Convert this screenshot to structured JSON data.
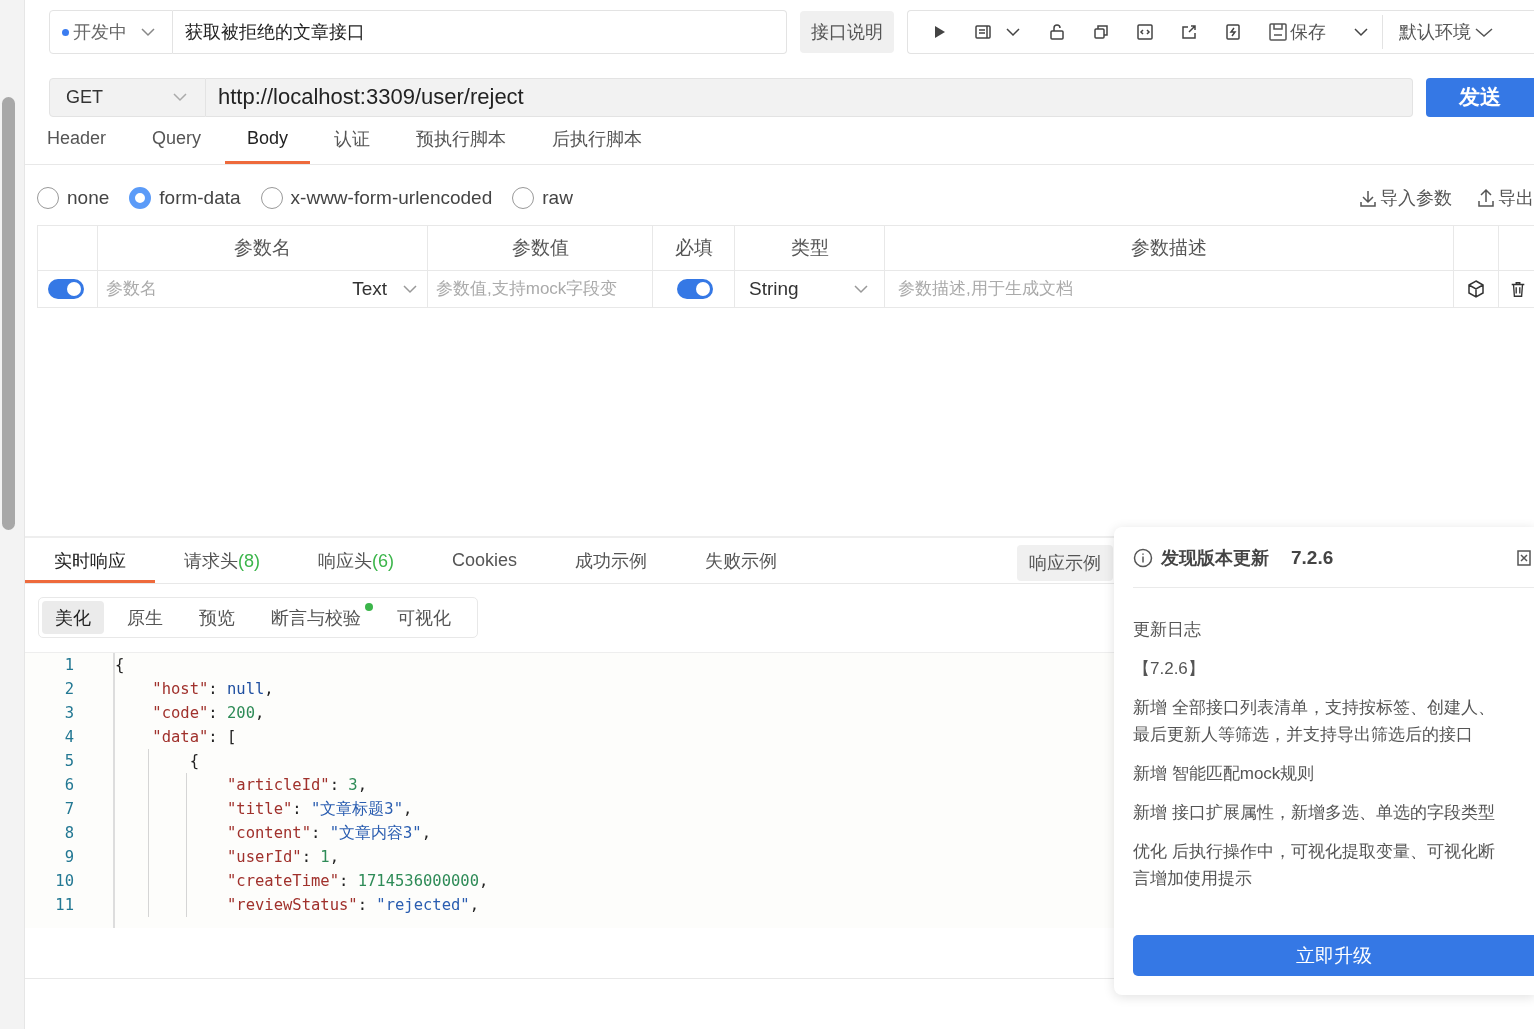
{
  "header": {
    "status": {
      "label": "开发中",
      "color": "#3b7cf0"
    },
    "name_value": "获取被拒绝的文章接口",
    "doc_button": "接口说明",
    "toolbar": {
      "save": "保存",
      "environment": "默认环境"
    }
  },
  "request": {
    "method": "GET",
    "url": "http://localhost:3309/user/reject",
    "send_button": "发送"
  },
  "tabs": [
    {
      "label": "Header",
      "selected": false
    },
    {
      "label": "Query",
      "selected": false
    },
    {
      "label": "Body",
      "selected": true
    },
    {
      "label": "认证",
      "selected": false
    },
    {
      "label": "预执行脚本",
      "selected": false
    },
    {
      "label": "后执行脚本",
      "selected": false
    }
  ],
  "body_types": [
    {
      "label": "none",
      "selected": false
    },
    {
      "label": "form-data",
      "selected": true
    },
    {
      "label": "x-www-form-urlencoded",
      "selected": false
    },
    {
      "label": "raw",
      "selected": false
    }
  ],
  "body_actions": [
    {
      "kind": "import",
      "label": "导入参数"
    },
    {
      "kind": "export",
      "label": "导出"
    }
  ],
  "params_table": {
    "columns": [
      "参数名",
      "参数值",
      "必填",
      "类型",
      "参数描述"
    ],
    "rows": [
      {
        "enabled": true,
        "name_placeholder": "参数名",
        "value_type": "Text",
        "value_placeholder": "参数值,支持mock字段变",
        "required": true,
        "type": "String",
        "description_placeholder": "参数描述,用于生成文档"
      }
    ]
  },
  "response": {
    "tabs": [
      {
        "label": "实时响应",
        "selected": true
      },
      {
        "label": "请求头",
        "count": "(8)",
        "selected": false
      },
      {
        "label": "响应头",
        "count": "(6)",
        "selected": false
      },
      {
        "label": "Cookies",
        "selected": false
      },
      {
        "label": "成功示例",
        "selected": false
      },
      {
        "label": "失败示例",
        "selected": false
      }
    ],
    "example_button": "响应示例",
    "view_tabs": [
      {
        "label": "美化",
        "selected": true,
        "dot": false
      },
      {
        "label": "原生",
        "selected": false,
        "dot": false
      },
      {
        "label": "预览",
        "selected": false,
        "dot": false
      },
      {
        "label": "断言与校验",
        "selected": false,
        "dot": true
      },
      {
        "label": "可视化",
        "selected": false,
        "dot": false
      }
    ],
    "code_lines": [
      {
        "number": "1",
        "text": "{"
      },
      {
        "number": "2",
        "text": "    \"host\": null,"
      },
      {
        "number": "3",
        "text": "    \"code\": 200,"
      },
      {
        "number": "4",
        "text": "    \"data\": ["
      },
      {
        "number": "5",
        "text": "        {"
      },
      {
        "number": "6",
        "text": "            \"articleId\": 3,"
      },
      {
        "number": "7",
        "text": "            \"title\": \"文章标题3\","
      },
      {
        "number": "8",
        "text": "            \"content\": \"文章内容3\","
      },
      {
        "number": "9",
        "text": "            \"userId\": 1,"
      },
      {
        "number": "10",
        "text": "            \"createTime\": 1714536000000,"
      },
      {
        "number": "11",
        "text": "            \"reviewStatus\": \"rejected\","
      }
    ]
  },
  "update_popup": {
    "title": "发现版本更新",
    "version": "7.2.6",
    "section": "更新日志",
    "release": "【7.2.6】",
    "notes": [
      "新增 全部接口列表清单，支持按标签、创建人、最后更新人等筛选，并支持导出筛选后的接口",
      "新增 智能匹配mock规则",
      "新增 接口扩展属性，新增多选、单选的字段类型",
      "优化 后执行操作中，可视化提取变量、可视化断言增加使用提示"
    ],
    "button": "立即升级"
  }
}
